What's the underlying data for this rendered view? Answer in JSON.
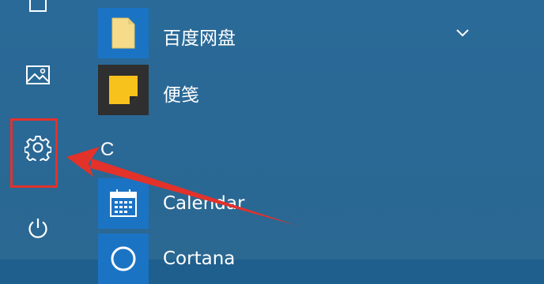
{
  "start_menu": {
    "apps": [
      {
        "label": "百度网盘",
        "icon": "folder-icon",
        "expandable": true
      },
      {
        "label": "便笺",
        "icon": "sticky-notes-icon"
      },
      {
        "label": "Calendar",
        "icon": "calendar-icon"
      },
      {
        "label": "Cortana",
        "icon": "cortana-icon"
      }
    ],
    "section_letter": "C",
    "rail": [
      {
        "name": "documents",
        "icon": "document-icon"
      },
      {
        "name": "pictures",
        "icon": "pictures-icon"
      },
      {
        "name": "settings",
        "icon": "gear-icon"
      },
      {
        "name": "power",
        "icon": "power-icon"
      }
    ]
  },
  "colors": {
    "background": "#2a6a98",
    "tile_blue": "#1b73c4",
    "annotation_red": "#e2322a"
  }
}
